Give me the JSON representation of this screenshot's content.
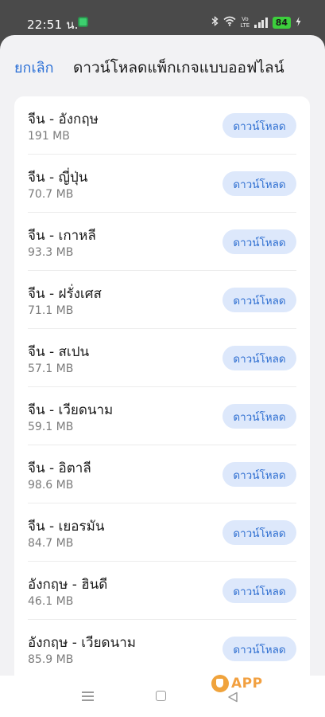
{
  "status_bar": {
    "time": "22:51 น.",
    "volte_top": "Vo",
    "volte_bottom": "LTE",
    "battery": "84",
    "icons": [
      "app-notification-icon",
      "bluetooth-icon",
      "wifi-icon",
      "volte-icon",
      "signal-icon",
      "battery-icon",
      "charging-icon"
    ]
  },
  "header": {
    "cancel_label": "ยกเลิก",
    "title": "ดาวน์โหลดแพ็กเกจแบบออฟไลน์"
  },
  "packages": [
    {
      "title": "จีน - อังกฤษ",
      "size": "191 MB",
      "button": "ดาวน์โหลด"
    },
    {
      "title": "จีน - ญี่ปุ่น",
      "size": "70.7 MB",
      "button": "ดาวน์โหลด"
    },
    {
      "title": "จีน - เกาหลี",
      "size": "93.3 MB",
      "button": "ดาวน์โหลด"
    },
    {
      "title": "จีน - ฝรั่งเศส",
      "size": "71.1 MB",
      "button": "ดาวน์โหลด"
    },
    {
      "title": "จีน - สเปน",
      "size": "57.1 MB",
      "button": "ดาวน์โหลด"
    },
    {
      "title": "จีน - เวียดนาม",
      "size": "59.1 MB",
      "button": "ดาวน์โหลด"
    },
    {
      "title": "จีน - อิตาลี",
      "size": "98.6 MB",
      "button": "ดาวน์โหลด"
    },
    {
      "title": "จีน - เยอรมัน",
      "size": "84.7 MB",
      "button": "ดาวน์โหลด"
    },
    {
      "title": "อังกฤษ - ฮินดี",
      "size": "46.1 MB",
      "button": "ดาวน์โหลด"
    },
    {
      "title": "อังกฤษ - เวียดนาม",
      "size": "85.9 MB",
      "button": "ดาวน์โหลด"
    }
  ],
  "nav_bar": {
    "icons": [
      "menu-icon",
      "home-icon",
      "back-icon"
    ]
  },
  "watermark": {
    "text": "APP"
  },
  "colors": {
    "accent": "#2a6fd6",
    "button_bg": "#dde8fb",
    "sheet_bg": "#f2f2f4",
    "battery": "#3ccf3c"
  }
}
